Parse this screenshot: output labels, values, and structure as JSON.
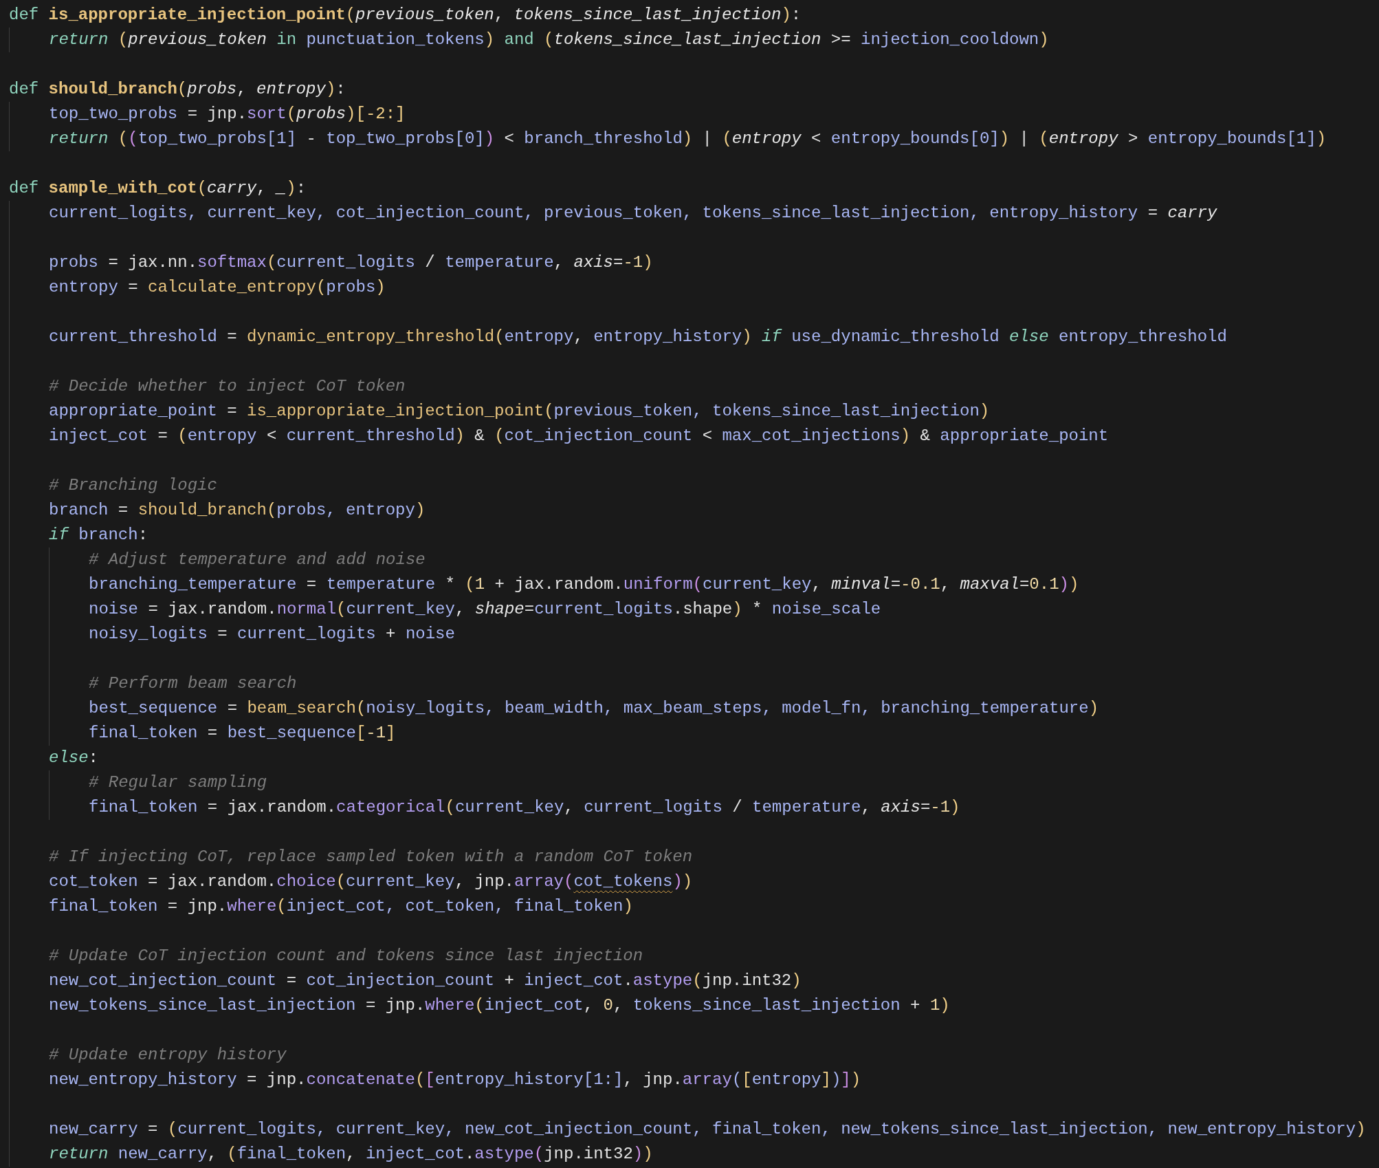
{
  "editor": {
    "lines": [
      {
        "kind": "code",
        "tokens": [
          {
            "text": "def",
            "kind": "kw"
          },
          {
            "lead": true,
            "text": "is_appropriate_injection_point",
            "kind": "fn"
          },
          {
            "text": "(",
            "kind": "paren"
          },
          {
            "text": "previous_token",
            "kind": "param"
          },
          {
            "text": ", ",
            "kind": "plain"
          },
          {
            "text": "tokens_since_last_injection",
            "kind": "param"
          },
          {
            "text": ")",
            "kind": "paren"
          },
          {
            "text": ":",
            "kind": "plain"
          }
        ],
        "children": [
          {
            "kind": "code",
            "tokens": [
              {
                "text": "return",
                "kind": "kwi"
              },
              {
                "lead": true,
                "text": "(",
                "kind": "paren"
              },
              {
                "text": "previous_token",
                "kind": "param"
              },
              {
                "lead": true,
                "text": "in",
                "kind": "kw"
              },
              {
                "lead": true,
                "text": "punctuation_tokens",
                "kind": "var"
              },
              {
                "text": ")",
                "kind": "paren"
              },
              {
                "lead": true,
                "text": "and",
                "kind": "kw"
              },
              {
                "lead": true,
                "text": "(",
                "kind": "paren"
              },
              {
                "text": "tokens_since_last_injection",
                "kind": "param"
              },
              {
                "text": " >= ",
                "kind": "plain"
              },
              {
                "text": "injection_cooldown",
                "kind": "var"
              },
              {
                "text": ")",
                "kind": "paren"
              }
            ]
          }
        ]
      },
      {
        "kind": "blank"
      },
      {
        "kind": "code",
        "tokens": [
          {
            "text": "def",
            "kind": "kw"
          },
          {
            "lead": true,
            "text": "should_branch",
            "kind": "fn"
          },
          {
            "text": "(",
            "kind": "paren"
          },
          {
            "text": "probs",
            "kind": "param"
          },
          {
            "text": ", ",
            "kind": "plain"
          },
          {
            "text": "entropy",
            "kind": "param"
          },
          {
            "text": ")",
            "kind": "paren"
          },
          {
            "text": ":",
            "kind": "plain"
          }
        ],
        "children": [
          {
            "kind": "code",
            "tokens": [
              {
                "text": "top_two_probs",
                "kind": "var"
              },
              {
                "text": " = jnp.",
                "kind": "plain"
              },
              {
                "text": "sort",
                "kind": "method"
              },
              {
                "text": "(",
                "kind": "paren"
              },
              {
                "text": "probs",
                "kind": "param"
              },
              {
                "text": ")[-2:]",
                "kind": "paren"
              }
            ]
          },
          {
            "kind": "code",
            "tokens": [
              {
                "text": "return",
                "kind": "kwi"
              },
              {
                "lead": true,
                "text": "(",
                "kind": "paren"
              },
              {
                "text": "(",
                "kind": "brk"
              },
              {
                "text": "top_two_probs[1]",
                "kind": "var"
              },
              {
                "text": " - ",
                "kind": "plain"
              },
              {
                "text": "top_two_probs[0]",
                "kind": "var"
              },
              {
                "text": ")",
                "kind": "brk"
              },
              {
                "text": " < ",
                "kind": "plain"
              },
              {
                "text": "branch_threshold",
                "kind": "var"
              },
              {
                "text": ")",
                "kind": "paren"
              },
              {
                "text": " | ",
                "kind": "plain"
              },
              {
                "text": "(",
                "kind": "paren"
              },
              {
                "text": "entropy",
                "kind": "param"
              },
              {
                "text": " < ",
                "kind": "plain"
              },
              {
                "text": "entropy_bounds[0]",
                "kind": "var"
              },
              {
                "text": ")",
                "kind": "paren"
              },
              {
                "text": " | ",
                "kind": "plain"
              },
              {
                "text": "(",
                "kind": "paren"
              },
              {
                "text": "entropy",
                "kind": "param"
              },
              {
                "text": " > ",
                "kind": "plain"
              },
              {
                "text": "entropy_bounds[1]",
                "kind": "var"
              },
              {
                "text": ")",
                "kind": "paren"
              }
            ]
          }
        ]
      },
      {
        "kind": "blank"
      },
      {
        "kind": "code",
        "tokens": [
          {
            "text": "def",
            "kind": "kw"
          },
          {
            "lead": true,
            "text": "sample_with_cot",
            "kind": "fn"
          },
          {
            "text": "(",
            "kind": "paren"
          },
          {
            "text": "carry",
            "kind": "param"
          },
          {
            "text": ", ",
            "kind": "plain"
          },
          {
            "text": "_",
            "kind": "param"
          },
          {
            "text": ")",
            "kind": "paren"
          },
          {
            "text": ":",
            "kind": "plain"
          }
        ],
        "children": [
          {
            "kind": "code",
            "tokens": [
              {
                "text": "current_logits, current_key, cot_injection_count, previous_token, tokens_since_last_injection, entropy_history",
                "kind": "var"
              },
              {
                "text": " = ",
                "kind": "plain"
              },
              {
                "text": "carry",
                "kind": "param"
              }
            ]
          },
          {
            "kind": "blank"
          },
          {
            "kind": "code",
            "tokens": [
              {
                "text": "probs",
                "kind": "var"
              },
              {
                "text": " = jax.nn.",
                "kind": "plain"
              },
              {
                "text": "softmax",
                "kind": "method"
              },
              {
                "text": "(",
                "kind": "paren"
              },
              {
                "text": "current_logits",
                "kind": "var"
              },
              {
                "text": " / ",
                "kind": "plain"
              },
              {
                "text": "temperature",
                "kind": "var"
              },
              {
                "text": ", ",
                "kind": "plain"
              },
              {
                "text": "axis",
                "kind": "param"
              },
              {
                "text": "=",
                "kind": "plain"
              },
              {
                "text": "-1",
                "kind": "num"
              },
              {
                "text": ")",
                "kind": "paren"
              }
            ]
          },
          {
            "kind": "code",
            "tokens": [
              {
                "text": "entropy",
                "kind": "var"
              },
              {
                "text": " = ",
                "kind": "plain"
              },
              {
                "text": "calculate_entropy",
                "kind": "call"
              },
              {
                "text": "(",
                "kind": "paren"
              },
              {
                "text": "probs",
                "kind": "var"
              },
              {
                "text": ")",
                "kind": "paren"
              }
            ]
          },
          {
            "kind": "blank"
          },
          {
            "kind": "code",
            "tokens": [
              {
                "text": "current_threshold",
                "kind": "var"
              },
              {
                "text": " = ",
                "kind": "plain"
              },
              {
                "text": "dynamic_entropy_threshold",
                "kind": "call"
              },
              {
                "text": "(",
                "kind": "paren"
              },
              {
                "text": "entropy",
                "kind": "var"
              },
              {
                "text": ", ",
                "kind": "plain"
              },
              {
                "text": "entropy_history",
                "kind": "var"
              },
              {
                "text": ")",
                "kind": "paren"
              },
              {
                "lead": true,
                "text": "if",
                "kind": "kwi"
              },
              {
                "lead": true,
                "text": "use_dynamic_threshold",
                "kind": "var"
              },
              {
                "lead": true,
                "text": "else",
                "kind": "kwi"
              },
              {
                "lead": true,
                "text": "entropy_threshold",
                "kind": "var"
              }
            ]
          },
          {
            "kind": "blank"
          },
          {
            "kind": "code",
            "tokens": [
              {
                "text": "# Decide whether to inject CoT token",
                "kind": "comment"
              }
            ]
          },
          {
            "kind": "code",
            "tokens": [
              {
                "text": "appropriate_point",
                "kind": "var"
              },
              {
                "text": " = ",
                "kind": "plain"
              },
              {
                "text": "is_appropriate_injection_point",
                "kind": "call"
              },
              {
                "text": "(",
                "kind": "paren"
              },
              {
                "text": "previous_token, tokens_since_last_injection",
                "kind": "var"
              },
              {
                "text": ")",
                "kind": "paren"
              }
            ]
          },
          {
            "kind": "code",
            "tokens": [
              {
                "text": "inject_cot",
                "kind": "var"
              },
              {
                "text": " = ",
                "kind": "plain"
              },
              {
                "text": "(",
                "kind": "paren"
              },
              {
                "text": "entropy",
                "kind": "var"
              },
              {
                "text": " < ",
                "kind": "plain"
              },
              {
                "text": "current_threshold",
                "kind": "var"
              },
              {
                "text": ")",
                "kind": "paren"
              },
              {
                "text": " & ",
                "kind": "plain"
              },
              {
                "text": "(",
                "kind": "paren"
              },
              {
                "text": "cot_injection_count",
                "kind": "var"
              },
              {
                "text": " < ",
                "kind": "plain"
              },
              {
                "text": "max_cot_injections",
                "kind": "var"
              },
              {
                "text": ")",
                "kind": "paren"
              },
              {
                "text": " & ",
                "kind": "plain"
              },
              {
                "text": "appropriate_point",
                "kind": "var"
              }
            ]
          },
          {
            "kind": "blank"
          },
          {
            "kind": "code",
            "tokens": [
              {
                "text": "# Branching logic",
                "kind": "comment"
              }
            ]
          },
          {
            "kind": "code",
            "tokens": [
              {
                "text": "branch",
                "kind": "var"
              },
              {
                "text": " = ",
                "kind": "plain"
              },
              {
                "text": "should_branch",
                "kind": "call"
              },
              {
                "text": "(",
                "kind": "paren"
              },
              {
                "text": "probs, entropy",
                "kind": "var"
              },
              {
                "text": ")",
                "kind": "paren"
              }
            ]
          },
          {
            "kind": "code",
            "tokens": [
              {
                "text": "if",
                "kind": "kwi"
              },
              {
                "lead": true,
                "text": "branch",
                "kind": "var"
              },
              {
                "text": ":",
                "kind": "plain"
              }
            ],
            "children": [
              {
                "kind": "code",
                "tokens": [
                  {
                    "text": "# Adjust temperature and add noise",
                    "kind": "comment"
                  }
                ]
              },
              {
                "kind": "code",
                "tokens": [
                  {
                    "text": "branching_temperature",
                    "kind": "var"
                  },
                  {
                    "text": " = ",
                    "kind": "plain"
                  },
                  {
                    "text": "temperature",
                    "kind": "var"
                  },
                  {
                    "text": " * ",
                    "kind": "plain"
                  },
                  {
                    "text": "(",
                    "kind": "paren"
                  },
                  {
                    "text": "1",
                    "kind": "num"
                  },
                  {
                    "text": " + jax.random.",
                    "kind": "plain"
                  },
                  {
                    "text": "uniform",
                    "kind": "method"
                  },
                  {
                    "text": "(",
                    "kind": "brk"
                  },
                  {
                    "text": "current_key",
                    "kind": "var"
                  },
                  {
                    "text": ", ",
                    "kind": "plain"
                  },
                  {
                    "text": "minval",
                    "kind": "param"
                  },
                  {
                    "text": "=",
                    "kind": "plain"
                  },
                  {
                    "text": "-0.1",
                    "kind": "num"
                  },
                  {
                    "text": ", ",
                    "kind": "plain"
                  },
                  {
                    "text": "maxval",
                    "kind": "param"
                  },
                  {
                    "text": "=",
                    "kind": "plain"
                  },
                  {
                    "text": "0.1",
                    "kind": "num"
                  },
                  {
                    "text": ")",
                    "kind": "brk"
                  },
                  {
                    "text": ")",
                    "kind": "paren"
                  }
                ]
              },
              {
                "kind": "code",
                "tokens": [
                  {
                    "text": "noise",
                    "kind": "var"
                  },
                  {
                    "text": " = jax.random.",
                    "kind": "plain"
                  },
                  {
                    "text": "normal",
                    "kind": "method"
                  },
                  {
                    "text": "(",
                    "kind": "paren"
                  },
                  {
                    "text": "current_key",
                    "kind": "var"
                  },
                  {
                    "text": ", ",
                    "kind": "plain"
                  },
                  {
                    "text": "shape",
                    "kind": "param"
                  },
                  {
                    "text": "=",
                    "kind": "plain"
                  },
                  {
                    "text": "current_logits",
                    "kind": "var"
                  },
                  {
                    "text": ".shape",
                    "kind": "plain"
                  },
                  {
                    "text": ")",
                    "kind": "paren"
                  },
                  {
                    "text": " * ",
                    "kind": "plain"
                  },
                  {
                    "text": "noise_scale",
                    "kind": "var"
                  }
                ]
              },
              {
                "kind": "code",
                "tokens": [
                  {
                    "text": "noisy_logits",
                    "kind": "var"
                  },
                  {
                    "text": " = ",
                    "kind": "plain"
                  },
                  {
                    "text": "current_logits",
                    "kind": "var"
                  },
                  {
                    "text": " + ",
                    "kind": "plain"
                  },
                  {
                    "text": "noise",
                    "kind": "var"
                  }
                ]
              },
              {
                "kind": "blank"
              },
              {
                "kind": "code",
                "tokens": [
                  {
                    "text": "# Perform beam search",
                    "kind": "comment"
                  }
                ]
              },
              {
                "kind": "code",
                "tokens": [
                  {
                    "text": "best_sequence",
                    "kind": "var"
                  },
                  {
                    "text": " = ",
                    "kind": "plain"
                  },
                  {
                    "text": "beam_search",
                    "kind": "call"
                  },
                  {
                    "text": "(",
                    "kind": "paren"
                  },
                  {
                    "text": "noisy_logits, beam_width, max_beam_steps, model_fn, branching_temperature",
                    "kind": "var"
                  },
                  {
                    "text": ")",
                    "kind": "paren"
                  }
                ]
              },
              {
                "kind": "code",
                "tokens": [
                  {
                    "text": "final_token",
                    "kind": "var"
                  },
                  {
                    "text": " = ",
                    "kind": "plain"
                  },
                  {
                    "text": "best_sequence",
                    "kind": "var"
                  },
                  {
                    "text": "[",
                    "kind": "paren"
                  },
                  {
                    "text": "-1",
                    "kind": "num"
                  },
                  {
                    "text": "]",
                    "kind": "paren"
                  }
                ]
              }
            ]
          },
          {
            "kind": "code",
            "tokens": [
              {
                "text": "else",
                "kind": "kwi"
              },
              {
                "text": ":",
                "kind": "plain"
              }
            ],
            "children": [
              {
                "kind": "code",
                "tokens": [
                  {
                    "text": "# Regular sampling",
                    "kind": "comment"
                  }
                ]
              },
              {
                "kind": "code",
                "tokens": [
                  {
                    "text": "final_token",
                    "kind": "var"
                  },
                  {
                    "text": " = jax.random.",
                    "kind": "plain"
                  },
                  {
                    "text": "categorical",
                    "kind": "method"
                  },
                  {
                    "text": "(",
                    "kind": "paren"
                  },
                  {
                    "text": "current_key",
                    "kind": "var"
                  },
                  {
                    "text": ", ",
                    "kind": "plain"
                  },
                  {
                    "text": "current_logits",
                    "kind": "var"
                  },
                  {
                    "text": " / ",
                    "kind": "plain"
                  },
                  {
                    "text": "temperature",
                    "kind": "var"
                  },
                  {
                    "text": ", ",
                    "kind": "plain"
                  },
                  {
                    "text": "axis",
                    "kind": "param"
                  },
                  {
                    "text": "=",
                    "kind": "plain"
                  },
                  {
                    "text": "-1",
                    "kind": "num"
                  },
                  {
                    "text": ")",
                    "kind": "paren"
                  }
                ]
              }
            ]
          },
          {
            "kind": "blank"
          },
          {
            "kind": "code",
            "tokens": [
              {
                "text": "# If injecting CoT, replace sampled token with a random CoT token",
                "kind": "comment"
              }
            ]
          },
          {
            "kind": "code",
            "tokens": [
              {
                "text": "cot_token",
                "kind": "var"
              },
              {
                "text": " = jax.random.",
                "kind": "plain"
              },
              {
                "text": "choice",
                "kind": "method"
              },
              {
                "text": "(",
                "kind": "paren"
              },
              {
                "text": "current_key",
                "kind": "var"
              },
              {
                "text": ", jnp.",
                "kind": "plain"
              },
              {
                "text": "array",
                "kind": "method"
              },
              {
                "text": "(",
                "kind": "brk"
              },
              {
                "text": "cot_tokens",
                "kind": "var",
                "warning": true
              },
              {
                "text": ")",
                "kind": "brk"
              },
              {
                "text": ")",
                "kind": "paren"
              }
            ]
          },
          {
            "kind": "code",
            "tokens": [
              {
                "text": "final_token",
                "kind": "var"
              },
              {
                "text": " = jnp.",
                "kind": "plain"
              },
              {
                "text": "where",
                "kind": "method"
              },
              {
                "text": "(",
                "kind": "paren"
              },
              {
                "text": "inject_cot, cot_token, final_token",
                "kind": "var"
              },
              {
                "text": ")",
                "kind": "paren"
              }
            ]
          },
          {
            "kind": "blank"
          },
          {
            "kind": "code",
            "tokens": [
              {
                "text": "# Update CoT injection count and tokens since last injection",
                "kind": "comment"
              }
            ]
          },
          {
            "kind": "code",
            "tokens": [
              {
                "text": "new_cot_injection_count",
                "kind": "var"
              },
              {
                "text": " = ",
                "kind": "plain"
              },
              {
                "text": "cot_injection_count",
                "kind": "var"
              },
              {
                "text": " + ",
                "kind": "plain"
              },
              {
                "text": "inject_cot",
                "kind": "var"
              },
              {
                "text": ".",
                "kind": "plain"
              },
              {
                "text": "astype",
                "kind": "method"
              },
              {
                "text": "(",
                "kind": "paren"
              },
              {
                "text": "jnp.int32",
                "kind": "plain"
              },
              {
                "text": ")",
                "kind": "paren"
              }
            ]
          },
          {
            "kind": "code",
            "tokens": [
              {
                "text": "new_tokens_since_last_injection",
                "kind": "var"
              },
              {
                "text": " = jnp.",
                "kind": "plain"
              },
              {
                "text": "where",
                "kind": "method"
              },
              {
                "text": "(",
                "kind": "paren"
              },
              {
                "text": "inject_cot",
                "kind": "var"
              },
              {
                "text": ", ",
                "kind": "plain"
              },
              {
                "text": "0",
                "kind": "num"
              },
              {
                "text": ", ",
                "kind": "plain"
              },
              {
                "text": "tokens_since_last_injection",
                "kind": "var"
              },
              {
                "text": " + ",
                "kind": "plain"
              },
              {
                "text": "1",
                "kind": "num"
              },
              {
                "text": ")",
                "kind": "paren"
              }
            ]
          },
          {
            "kind": "blank"
          },
          {
            "kind": "code",
            "tokens": [
              {
                "text": "# Update entropy history",
                "kind": "comment"
              }
            ]
          },
          {
            "kind": "code",
            "tokens": [
              {
                "text": "new_entropy_history",
                "kind": "var"
              },
              {
                "text": " = jnp.",
                "kind": "plain"
              },
              {
                "text": "concatenate",
                "kind": "method"
              },
              {
                "text": "(",
                "kind": "paren"
              },
              {
                "text": "[",
                "kind": "brk"
              },
              {
                "text": "entropy_history[1:]",
                "kind": "var"
              },
              {
                "text": ", jnp.",
                "kind": "plain"
              },
              {
                "text": "array",
                "kind": "method"
              },
              {
                "text": "(",
                "kind": "var"
              },
              {
                "text": "[",
                "kind": "paren"
              },
              {
                "text": "entropy",
                "kind": "var"
              },
              {
                "text": "]",
                "kind": "paren"
              },
              {
                "text": ")",
                "kind": "var"
              },
              {
                "text": "]",
                "kind": "brk"
              },
              {
                "text": ")",
                "kind": "paren"
              }
            ]
          },
          {
            "kind": "blank"
          },
          {
            "kind": "code",
            "tokens": [
              {
                "text": "new_carry",
                "kind": "var"
              },
              {
                "text": " = ",
                "kind": "plain"
              },
              {
                "text": "(",
                "kind": "paren"
              },
              {
                "text": "current_logits, current_key, new_cot_injection_count, final_token, new_tokens_since_last_injection, new_entropy_history",
                "kind": "var"
              },
              {
                "text": ")",
                "kind": "paren"
              }
            ]
          },
          {
            "kind": "code",
            "tokens": [
              {
                "text": "return",
                "kind": "kwi"
              },
              {
                "lead": true,
                "text": "new_carry",
                "kind": "var"
              },
              {
                "text": ", ",
                "kind": "plain"
              },
              {
                "text": "(",
                "kind": "paren"
              },
              {
                "text": "final_token",
                "kind": "var"
              },
              {
                "text": ", ",
                "kind": "plain"
              },
              {
                "text": "inject_cot",
                "kind": "var"
              },
              {
                "text": ".",
                "kind": "plain"
              },
              {
                "text": "astype",
                "kind": "method"
              },
              {
                "text": "(",
                "kind": "brk"
              },
              {
                "text": "jnp.int32",
                "kind": "plain"
              },
              {
                "text": ")",
                "kind": "brk"
              },
              {
                "text": ")",
                "kind": "paren"
              }
            ]
          }
        ]
      }
    ]
  }
}
